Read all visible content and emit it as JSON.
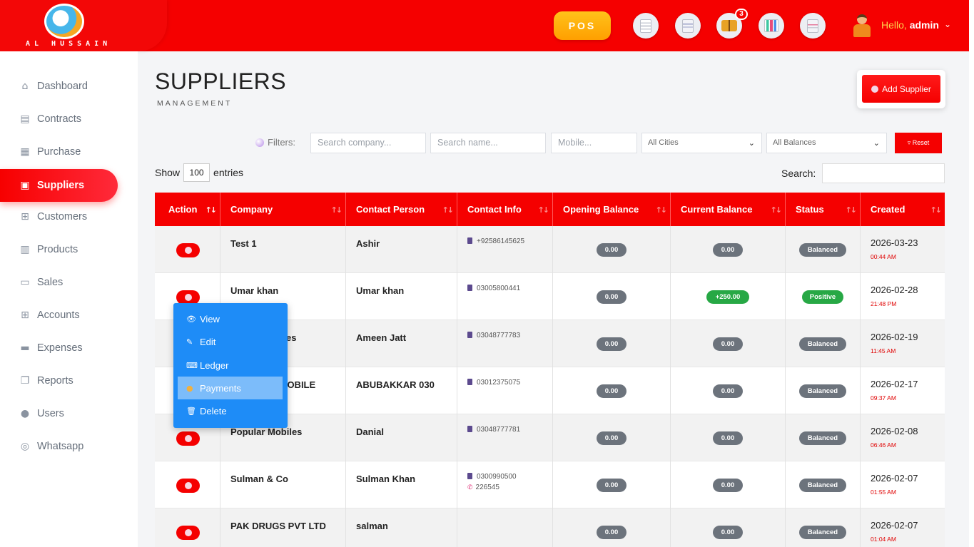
{
  "brand": {
    "logo_text": "AL HUSSAIN"
  },
  "topbar": {
    "pos_label": "POS",
    "notification_count": "3",
    "greeting": "Hello,",
    "username": "admin"
  },
  "sidebar": {
    "items": [
      {
        "label": "Dashboard",
        "icon": "home-icon"
      },
      {
        "label": "Contracts",
        "icon": "document-icon"
      },
      {
        "label": "Purchase",
        "icon": "archive-icon"
      },
      {
        "label": "Suppliers",
        "icon": "id-card-icon"
      },
      {
        "label": "Customers",
        "icon": "sitemap-icon"
      },
      {
        "label": "Products",
        "icon": "barcode-icon"
      },
      {
        "label": "Sales",
        "icon": "laptop-icon"
      },
      {
        "label": "Accounts",
        "icon": "grid-icon"
      },
      {
        "label": "Expenses",
        "icon": "wallet-icon"
      },
      {
        "label": "Reports",
        "icon": "window-icon"
      },
      {
        "label": "Users",
        "icon": "user-icon"
      },
      {
        "label": "Whatsapp",
        "icon": "fingerprint-icon"
      }
    ]
  },
  "header": {
    "title": "SUPPLIERS",
    "subtitle": "MANAGEMENT",
    "add_label": "Add Supplier"
  },
  "filters": {
    "label": "Filters:",
    "company_placeholder": "Search company...",
    "name_placeholder": "Search name...",
    "mobile_placeholder": "Mobile...",
    "city_value": "All Cities",
    "balance_value": "All Balances",
    "reset_label": "Reset"
  },
  "table_controls": {
    "show_label": "Show",
    "entries_value": "100",
    "entries_label": "entries",
    "search_label": "Search:"
  },
  "table": {
    "columns": [
      "Action",
      "Company",
      "Contact Person",
      "Contact Info",
      "Opening Balance",
      "Current Balance",
      "Status",
      "Created"
    ],
    "rows": [
      {
        "company": "Test 1",
        "person": "Ashir",
        "phone": "+92586145625",
        "tel": "",
        "opening": "0.00",
        "current": "0.00",
        "status": "Balanced",
        "date": "2026-03-23",
        "time": "00:44 AM"
      },
      {
        "company": "Umar khan",
        "person": "Umar khan",
        "phone": "03005800441",
        "tel": "",
        "opening": "0.00",
        "current": "+250.00",
        "status": "Positive",
        "date": "2026-02-28",
        "time": "21:48 PM"
      },
      {
        "company": "Ghalib Mobiles",
        "person": "Ameen Jatt",
        "phone": "03048777783",
        "tel": "",
        "opening": "0.00",
        "current": "0.00",
        "status": "Balanced",
        "date": "2026-02-19",
        "time": "11:45 AM"
      },
      {
        "company": "CHOHDRY MOBILE",
        "person": "ABUBAKKAR 030",
        "phone": "03012375075",
        "tel": "",
        "opening": "0.00",
        "current": "0.00",
        "status": "Balanced",
        "date": "2026-02-17",
        "time": "09:37 AM"
      },
      {
        "company": "Popular Mobiles",
        "person": "Danial",
        "phone": "03048777781",
        "tel": "",
        "opening": "0.00",
        "current": "0.00",
        "status": "Balanced",
        "date": "2026-02-08",
        "time": "06:46 AM"
      },
      {
        "company": "Sulman & Co",
        "person": "Sulman Khan",
        "phone": "0300990500",
        "tel": "226545",
        "opening": "0.00",
        "current": "0.00",
        "status": "Balanced",
        "date": "2026-02-07",
        "time": "01:55 AM"
      },
      {
        "company": "PAK DRUGS PVT LTD",
        "person": "salman",
        "phone": "",
        "tel": "",
        "opening": "0.00",
        "current": "0.00",
        "status": "Balanced",
        "date": "2026-02-07",
        "time": "01:04 AM"
      }
    ]
  },
  "action_menu": {
    "items": [
      {
        "label": "View",
        "icon": "eye-icon"
      },
      {
        "label": "Edit",
        "icon": "pencil-icon"
      },
      {
        "label": "Ledger",
        "icon": "keyboard-icon"
      },
      {
        "label": "Payments",
        "icon": "money-bag-icon"
      },
      {
        "label": "Delete",
        "icon": "trash-icon"
      }
    ],
    "hovered": "Payments"
  },
  "colors": {
    "brand_red": "#f50000",
    "pos_gold": "#ffb000",
    "menu_blue": "#1e8cf7",
    "status_gray": "#6c737c",
    "status_green": "#27a845"
  }
}
